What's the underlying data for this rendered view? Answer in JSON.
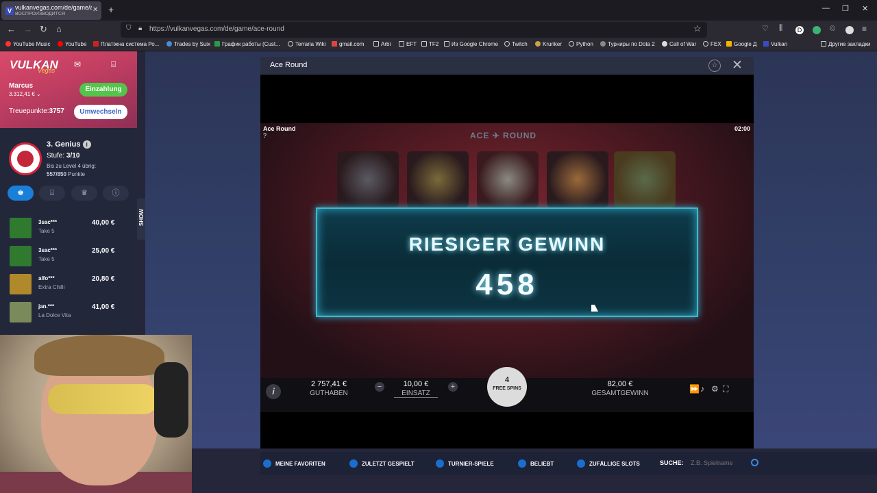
{
  "browser": {
    "tab_title": "vulkanvegas.com/de/game/ac",
    "tab_subtitle": "ВОСПРОИЗВОДИТСЯ",
    "tab_favicon": "V",
    "url": "https://vulkanvegas.com/de/game/ace-round",
    "bookmarks": [
      "YouTube Music",
      "YouTube",
      "Платіжна система Ро...",
      "Trades by Suix",
      "График работы (Cust...",
      "Terraria Wiki",
      "gmail.com",
      "Arbi",
      "EFT",
      "TF2",
      "Из Google Chrome",
      "Twitch",
      "Krunker",
      "Python",
      "Турниры по Dota 2",
      "Call of War",
      "FEX",
      "Google Д",
      "Vulkan"
    ],
    "other_bookmarks": "Другие закладки"
  },
  "sidebar": {
    "logo": "VULKAN",
    "logo_sub": "Vegas",
    "username": "Marcus",
    "balance": "3.312,41 € ⌄",
    "deposit_label": "Einzahlung",
    "loyalty_label": "Treuepunkte:",
    "loyalty_points": "3757",
    "exchange_label": "Umwechseln",
    "level_name": "3. Genius",
    "stufe_label": "Stufe:",
    "stufe_value": "3/10",
    "to_level": "Bis zu Level 4 übrig:",
    "points_progress": "557/850",
    "points_unit": "Punkte",
    "wins": [
      {
        "name": "3sac***",
        "game": "Take 5",
        "amount": "40,00 €",
        "color": "#2f7a2f"
      },
      {
        "name": "3sac***",
        "game": "Take 5",
        "amount": "25,00 €",
        "color": "#2f7a2f"
      },
      {
        "name": "alfo***",
        "game": "Extra Chilli",
        "amount": "20,80 €",
        "color": "#b0892a"
      },
      {
        "name": "jan.***",
        "game": "La Dolce Vita",
        "amount": "41,00 €",
        "color": "#7a8a5a"
      }
    ],
    "show_label": "SHOW"
  },
  "modal": {
    "title": "Ace Round",
    "game_hud_name": "Ace Round",
    "game_hud_q": "?",
    "timer": "02:00",
    "game_logo": "ACE ✈ ROUND",
    "win_title": "RIESIGER GEWINN",
    "win_amount": "458",
    "balance_value": "2 757,41 €",
    "balance_label": "GUTHABEN",
    "bet_value": "10,00 €",
    "bet_label": "EINSATZ",
    "free_spins_count": "4",
    "free_spins_label": "FREE SPINS",
    "total_win_value": "82,00 €",
    "total_win_label": "GESAMTGEWINN"
  },
  "bottom_nav": {
    "favorites": "MEINE FAVORITEN",
    "recent": "ZULETZT GESPIELT",
    "tournament": "TURNIER-SPIELE",
    "popular": "BELIEBT",
    "random": "ZUFÄLLIGE SLOTS",
    "search_label": "SUCHE:",
    "search_placeholder": "Z.B. Spielname"
  },
  "colors": {
    "accent": "#1a7fd8",
    "deposit": "#54c44a",
    "win_border": "#48b4cc"
  }
}
